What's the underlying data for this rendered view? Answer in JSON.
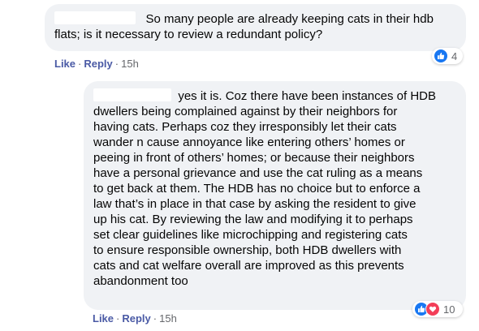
{
  "comments": [
    {
      "lines": [
        "So many people are already keeping cats in their hdb",
        "flats; is it necessary to review a redundant policy?"
      ],
      "actions": {
        "like": "Like",
        "reply": "Reply",
        "time": "15h"
      },
      "reactions": {
        "types": [
          "like-icon"
        ],
        "count": "4"
      }
    },
    {
      "lines": [
        "yes it is. Coz there have been instances of HDB",
        "dwellers being complained against by their neighbors for",
        "having cats. Perhaps coz they irresponsibly let their cats",
        "wander n cause annoyance like entering others’ homes or",
        "peeing in front of others’ homes; or because their neighbors",
        "have a personal grievance and use the cat ruling as a means",
        "to get back at them. The HDB has no choice but to enforce a",
        "law that’s in place in that case by asking the resident to give",
        "up his cat. By reviewing the law and modifying it to perhaps",
        "set clear guidelines like microchipping and registering cats",
        "to ensure responsible ownership, both HDB dwellers with",
        "cats and cat welfare overall are improved as this prevents",
        "abandonment too"
      ],
      "actions": {
        "like": "Like",
        "reply": "Reply",
        "time": "15h"
      },
      "reactions": {
        "types": [
          "like-icon",
          "love-icon"
        ],
        "count": "10"
      }
    }
  ],
  "colors": {
    "bubble": "#f0f2f5",
    "action_link": "#4a5aa5",
    "meta": "#65676b",
    "like": "#1877f2",
    "love": "#f33e58"
  }
}
